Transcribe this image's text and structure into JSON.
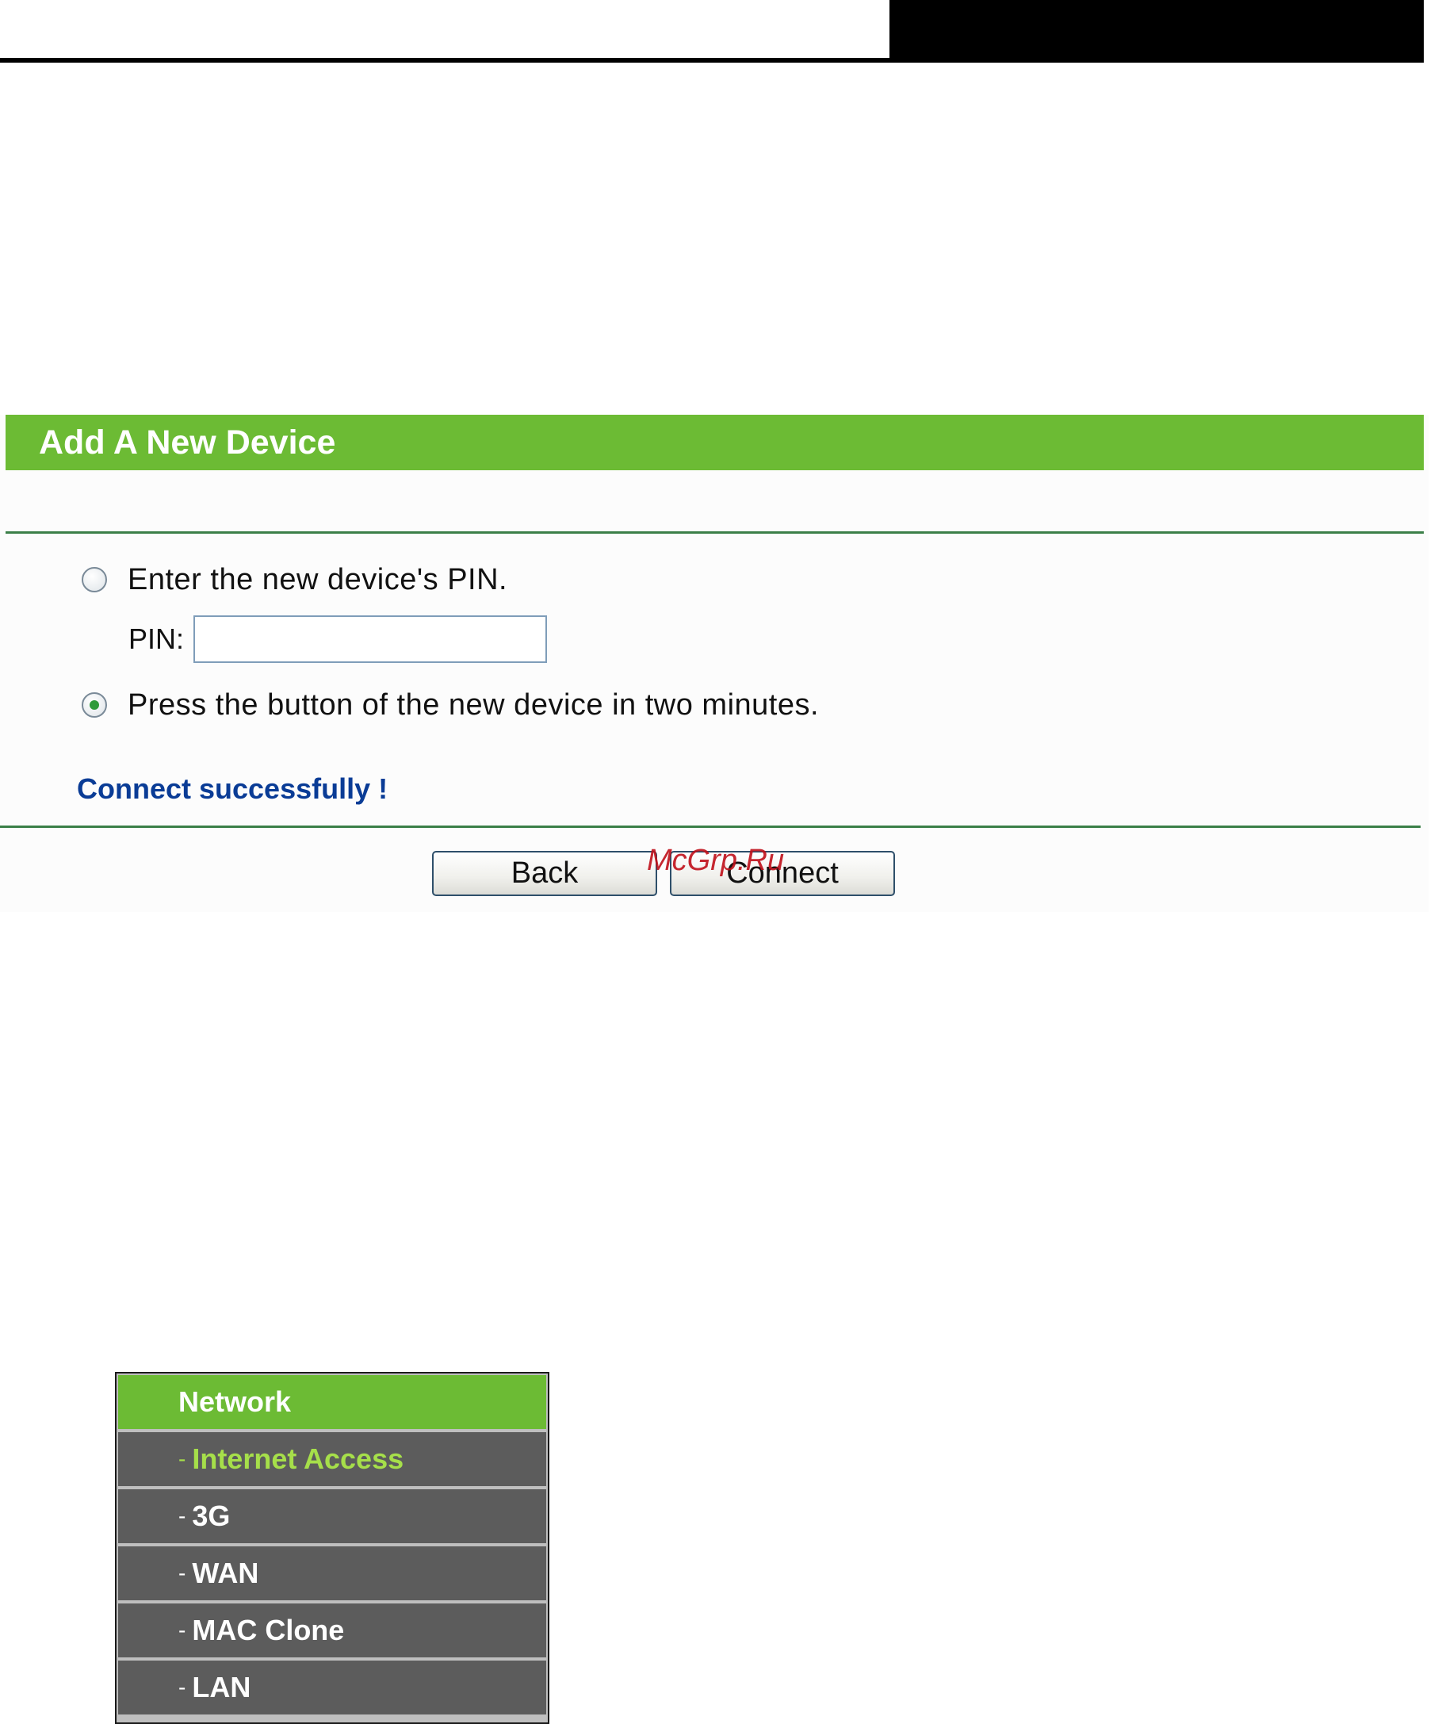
{
  "panel": {
    "title": "Add A New Device",
    "option_pin_label": "Enter the new device's PIN.",
    "pin_label": "PIN:",
    "pin_value": "",
    "option_button_label": "Press the button of the new device in two minutes.",
    "selected_option": "button",
    "status_message": "Connect successfully !",
    "back_label": "Back",
    "connect_label": "Connect"
  },
  "watermark": "McGrp.Ru",
  "menu": {
    "header": "Network",
    "items": [
      {
        "dash": "-",
        "label": "Internet Access",
        "active": true
      },
      {
        "dash": "-",
        "label": "3G",
        "active": false
      },
      {
        "dash": "-",
        "label": "WAN",
        "active": false
      },
      {
        "dash": "-",
        "label": "MAC Clone",
        "active": false
      },
      {
        "dash": "-",
        "label": "LAN",
        "active": false
      }
    ]
  },
  "colors": {
    "header_green": "#6cbb34",
    "status_blue": "#0a3c96",
    "menu_gray": "#5c5c5c",
    "active_green": "#a6df4a"
  }
}
